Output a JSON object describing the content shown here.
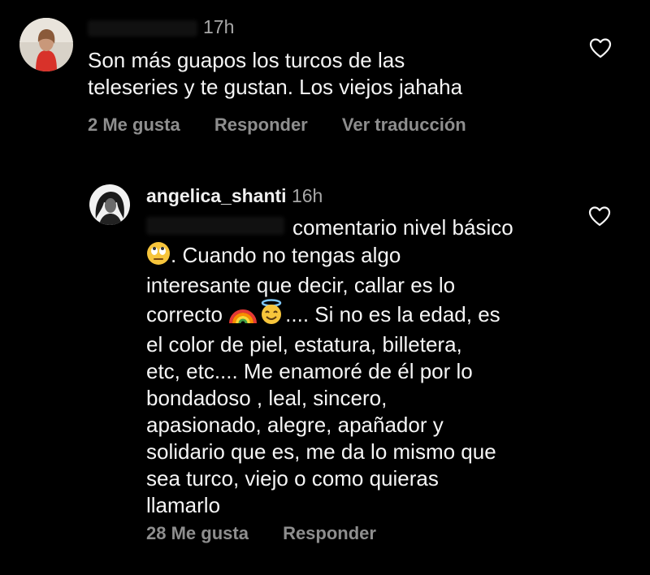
{
  "comment1": {
    "time": "17h",
    "text_line1": "Son más guapos los turcos de las",
    "text_line2": "teleseries y te gustan. Los viejos jahaha",
    "likes": "2 Me gusta",
    "reply": "Responder",
    "translate": "Ver traducción"
  },
  "comment2": {
    "username": "angelica_shanti",
    "time": "16h",
    "line1": "comentario nivel básico",
    "line2": ". Cuando no tengas algo",
    "line3": "interesante que decir, callar es lo",
    "line4a": "correcto",
    "line4b": ".... Si no es la edad, es",
    "line5": "el color de piel, estatura, billetera,",
    "line6": "etc, etc.... Me enamoré de él por lo",
    "line7": "bondadoso , leal, sincero,",
    "line8": "apasionado, alegre, apañador y",
    "line9": "solidario que es, me da lo mismo que",
    "line10": "sea turco, viejo o como quieras",
    "line11": "llamarlo",
    "likes": "28 Me gusta",
    "reply": "Responder"
  },
  "icons": {
    "like": "heart-outline-icon",
    "eye_roll": "face-with-rolling-eyes-emoji",
    "rainbow": "rainbow-emoji",
    "halo": "smiling-face-with-halo-emoji"
  },
  "colors": {
    "background": "#000000",
    "text": "#f5f5f5",
    "secondary": "#8e8e8e"
  }
}
